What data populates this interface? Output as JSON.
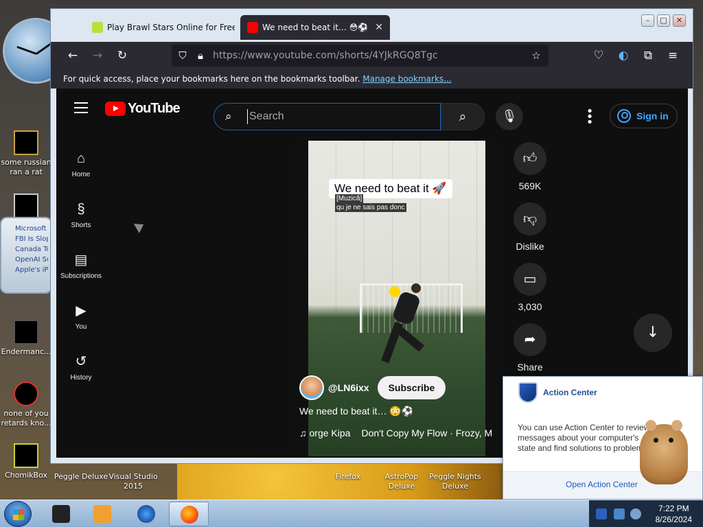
{
  "desktop": {
    "icons": [
      {
        "label": "some russian ran a rat"
      },
      {
        "label": ""
      },
      {
        "label": "Endermanc..."
      },
      {
        "label": "none of you retards kno..."
      },
      {
        "label": "ChomikBox"
      }
    ],
    "news_gadget": [
      "Microsoft E",
      "FBI Is Slop",
      "Canada To",
      "OpenAI Su",
      "Apple's iPh"
    ],
    "bottom_labels": [
      "Peggle Deluxe",
      "Visual Studio 2015",
      "Firefox",
      "AstroPop Deluxe",
      "Peggle Nights Deluxe"
    ]
  },
  "browser": {
    "tabs": [
      {
        "title": "Play Brawl Stars Online for Free",
        "fav_color": "#b8e03a",
        "active": false
      },
      {
        "title": "We need to beat it… 😳⚽ - You",
        "fav_color": "#ff0000",
        "active": true
      }
    ],
    "window_buttons": {
      "minimize": "–",
      "maximize": "□",
      "close": "✕"
    },
    "url": "https://www.youtube.com/shorts/4YJkRGQ8Tgc",
    "bookmarks_text": "For quick access, place your bookmarks here on the bookmarks toolbar.",
    "bookmarks_link": "Manage bookmarks..."
  },
  "youtube": {
    "logo_text": "YouTube",
    "search_placeholder": "Search",
    "sign_in": "Sign in",
    "sidebar": [
      {
        "label": "Home",
        "icon": "home-icon",
        "glyph": "⌂"
      },
      {
        "label": "Shorts",
        "icon": "shorts-icon",
        "glyph": "§"
      },
      {
        "label": "Subscriptions",
        "icon": "subscriptions-icon",
        "glyph": "▤"
      },
      {
        "label": "You",
        "icon": "you-icon",
        "glyph": "▶"
      },
      {
        "label": "History",
        "icon": "history-icon",
        "glyph": "↺"
      }
    ],
    "short": {
      "overlay_caption": "We need to beat it 🚀",
      "subtitle_line1": "[Muzică]",
      "subtitle_line2": "qu je ne sais pas donc",
      "channel": "@LN6ixx",
      "subscribe": "Subscribe",
      "title": "We need to beat it… 😳⚽",
      "music_artist": "orge Kipa",
      "music_track": "Don't Copy My Flow · Frozy, Mw"
    },
    "actions": {
      "likes": "569K",
      "dislike": "Dislike",
      "comments": "3,030",
      "share": "Share"
    }
  },
  "action_center": {
    "title": "Action Center",
    "body": "You can use Action Center to review messages about your computer's state and find solutions to problems.",
    "link": "Open Action Center"
  },
  "taskbar": {
    "time": "7:22 PM",
    "date": "8/26/2024"
  }
}
